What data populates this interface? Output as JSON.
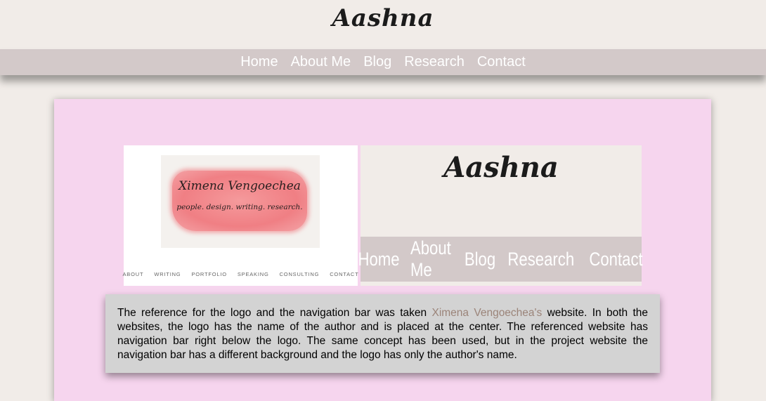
{
  "header": {
    "logo_text": "Aashna"
  },
  "nav": {
    "items": [
      {
        "label": "Home"
      },
      {
        "label": "About Me"
      },
      {
        "label": "Blog"
      },
      {
        "label": "Research"
      },
      {
        "label": "Contact"
      }
    ]
  },
  "reference_screenshot": {
    "brand_name": "Ximena Vengoechea",
    "tagline": "people. design. writing. research.",
    "nav_items": [
      "ABOUT",
      "WRITING",
      "PORTFOLIO",
      "SPEAKING",
      "CONSULTING",
      "CONTACT"
    ]
  },
  "project_screenshot": {
    "logo_text": "Aashna",
    "nav_items": [
      "Home",
      "About Me",
      "Blog",
      "Research",
      "Contact"
    ]
  },
  "caption": {
    "text_before": "The reference for the logo and the navigation bar was taken ",
    "link_text": "Ximena Vengoechea's",
    "text_after": " website. In both the websites, the logo has the name of the author and is placed at the center. The referenced website has navigation bar right below the logo. The same concept has been used, but in the project website the navigation bar has a different background and the logo has only the author's name."
  },
  "colors": {
    "page_background": "#f1ece8",
    "navbar": "#d3c9c9",
    "card_background": "#f6d5ee",
    "caption_background": "#d3d3d3",
    "link": "#9b8479"
  }
}
